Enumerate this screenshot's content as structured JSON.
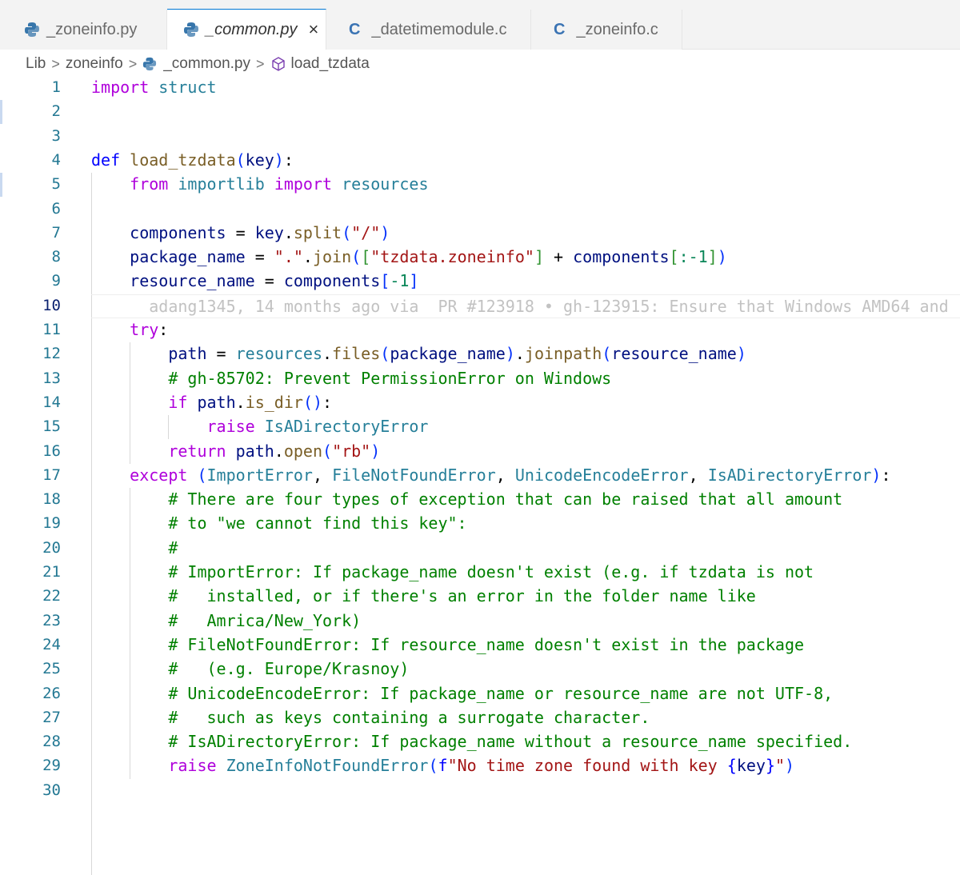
{
  "tabs": [
    {
      "label": "_zoneinfo.py",
      "icon": "python-icon",
      "active": false
    },
    {
      "label": "_common.py",
      "icon": "python-icon",
      "active": true,
      "close": "×"
    },
    {
      "label": "_datetimemodule.c",
      "icon": "c-icon",
      "icon_text": "C",
      "active": false
    },
    {
      "label": "_zoneinfo.c",
      "icon": "c-icon",
      "icon_text": "C",
      "active": false
    }
  ],
  "breadcrumb": {
    "items": [
      "Lib",
      "zoneinfo",
      "_common.py",
      "load_tzdata"
    ],
    "separator": ">"
  },
  "editor": {
    "current_line": 10,
    "line_numbers": [
      "1",
      "2",
      "3",
      "4",
      "5",
      "6",
      "7",
      "8",
      "9",
      "10",
      "11",
      "12",
      "13",
      "14",
      "15",
      "16",
      "17",
      "18",
      "19",
      "20",
      "21",
      "22",
      "23",
      "24",
      "25",
      "26",
      "27",
      "28",
      "29",
      "30"
    ],
    "lines": [
      [
        {
          "t": "import",
          "c": "k"
        },
        {
          "t": " "
        },
        {
          "t": "struct",
          "c": "t"
        }
      ],
      [],
      [],
      [
        {
          "t": "def",
          "c": "kd"
        },
        {
          "t": " "
        },
        {
          "t": "load_tzdata",
          "c": "fn"
        },
        {
          "t": "(",
          "c": "b1"
        },
        {
          "t": "key",
          "c": "v"
        },
        {
          "t": ")",
          "c": "b1"
        },
        {
          "t": ":"
        }
      ],
      [
        {
          "t": "    "
        },
        {
          "t": "from",
          "c": "k"
        },
        {
          "t": " "
        },
        {
          "t": "importlib",
          "c": "t"
        },
        {
          "t": " "
        },
        {
          "t": "import",
          "c": "k"
        },
        {
          "t": " "
        },
        {
          "t": "resources",
          "c": "t"
        }
      ],
      [],
      [
        {
          "t": "    "
        },
        {
          "t": "components",
          "c": "v"
        },
        {
          "t": " = "
        },
        {
          "t": "key",
          "c": "v"
        },
        {
          "t": "."
        },
        {
          "t": "split",
          "c": "fn"
        },
        {
          "t": "(",
          "c": "b1"
        },
        {
          "t": "\"/\"",
          "c": "s"
        },
        {
          "t": ")",
          "c": "b1"
        }
      ],
      [
        {
          "t": "    "
        },
        {
          "t": "package_name",
          "c": "v"
        },
        {
          "t": " = "
        },
        {
          "t": "\".\"",
          "c": "s"
        },
        {
          "t": "."
        },
        {
          "t": "join",
          "c": "fn"
        },
        {
          "t": "(",
          "c": "b1"
        },
        {
          "t": "[",
          "c": "b2"
        },
        {
          "t": "\"tzdata.zoneinfo\"",
          "c": "s"
        },
        {
          "t": "]",
          "c": "b2"
        },
        {
          "t": " + "
        },
        {
          "t": "components",
          "c": "v"
        },
        {
          "t": "[",
          "c": "b2"
        },
        {
          "t": ":-1",
          "c": "m"
        },
        {
          "t": "]",
          "c": "b2"
        },
        {
          "t": ")",
          "c": "b1"
        }
      ],
      [
        {
          "t": "    "
        },
        {
          "t": "resource_name",
          "c": "v"
        },
        {
          "t": " = "
        },
        {
          "t": "components",
          "c": "v"
        },
        {
          "t": "[",
          "c": "b1"
        },
        {
          "t": "-1",
          "c": "m"
        },
        {
          "t": "]",
          "c": "b1"
        }
      ],
      [
        {
          "t": "      adang1345, 14 months ago via  PR #123918 • gh-123915: Ensure that Windows AMD64 and",
          "c": "blame"
        }
      ],
      [
        {
          "t": "    "
        },
        {
          "t": "try",
          "c": "k"
        },
        {
          "t": ":"
        }
      ],
      [
        {
          "t": "        "
        },
        {
          "t": "path",
          "c": "v"
        },
        {
          "t": " = "
        },
        {
          "t": "resources",
          "c": "t"
        },
        {
          "t": "."
        },
        {
          "t": "files",
          "c": "fn"
        },
        {
          "t": "(",
          "c": "b1"
        },
        {
          "t": "package_name",
          "c": "v"
        },
        {
          "t": ")",
          "c": "b1"
        },
        {
          "t": "."
        },
        {
          "t": "joinpath",
          "c": "fn"
        },
        {
          "t": "(",
          "c": "b1"
        },
        {
          "t": "resource_name",
          "c": "v"
        },
        {
          "t": ")",
          "c": "b1"
        }
      ],
      [
        {
          "t": "        "
        },
        {
          "t": "# gh-85702: Prevent PermissionError on Windows",
          "c": "c"
        }
      ],
      [
        {
          "t": "        "
        },
        {
          "t": "if",
          "c": "k"
        },
        {
          "t": " "
        },
        {
          "t": "path",
          "c": "v"
        },
        {
          "t": "."
        },
        {
          "t": "is_dir",
          "c": "fn"
        },
        {
          "t": "()",
          "c": "b1"
        },
        {
          "t": ":"
        }
      ],
      [
        {
          "t": "            "
        },
        {
          "t": "raise",
          "c": "k"
        },
        {
          "t": " "
        },
        {
          "t": "IsADirectoryError",
          "c": "t"
        }
      ],
      [
        {
          "t": "        "
        },
        {
          "t": "return",
          "c": "k"
        },
        {
          "t": " "
        },
        {
          "t": "path",
          "c": "v"
        },
        {
          "t": "."
        },
        {
          "t": "open",
          "c": "fn"
        },
        {
          "t": "(",
          "c": "b1"
        },
        {
          "t": "\"rb\"",
          "c": "s"
        },
        {
          "t": ")",
          "c": "b1"
        }
      ],
      [
        {
          "t": "    "
        },
        {
          "t": "except",
          "c": "k"
        },
        {
          "t": " "
        },
        {
          "t": "(",
          "c": "b1"
        },
        {
          "t": "ImportError",
          "c": "t"
        },
        {
          "t": ", "
        },
        {
          "t": "FileNotFoundError",
          "c": "t"
        },
        {
          "t": ", "
        },
        {
          "t": "UnicodeEncodeError",
          "c": "t"
        },
        {
          "t": ", "
        },
        {
          "t": "IsADirectoryError",
          "c": "t"
        },
        {
          "t": ")",
          "c": "b1"
        },
        {
          "t": ":"
        }
      ],
      [
        {
          "t": "        "
        },
        {
          "t": "# There are four types of exception that can be raised that all amount",
          "c": "c"
        }
      ],
      [
        {
          "t": "        "
        },
        {
          "t": "# to \"we cannot find this key\":",
          "c": "c"
        }
      ],
      [
        {
          "t": "        "
        },
        {
          "t": "#",
          "c": "c"
        }
      ],
      [
        {
          "t": "        "
        },
        {
          "t": "# ImportError: If package_name doesn't exist (e.g. if tzdata is not",
          "c": "c"
        }
      ],
      [
        {
          "t": "        "
        },
        {
          "t": "#   installed, or if there's an error in the folder name like",
          "c": "c"
        }
      ],
      [
        {
          "t": "        "
        },
        {
          "t": "#   Amrica/New_York)",
          "c": "c"
        }
      ],
      [
        {
          "t": "        "
        },
        {
          "t": "# FileNotFoundError: If resource_name doesn't exist in the package",
          "c": "c"
        }
      ],
      [
        {
          "t": "        "
        },
        {
          "t": "#   (e.g. Europe/Krasnoy)",
          "c": "c"
        }
      ],
      [
        {
          "t": "        "
        },
        {
          "t": "# UnicodeEncodeError: If package_name or resource_name are not UTF-8,",
          "c": "c"
        }
      ],
      [
        {
          "t": "        "
        },
        {
          "t": "#   such as keys containing a surrogate character.",
          "c": "c"
        }
      ],
      [
        {
          "t": "        "
        },
        {
          "t": "# IsADirectoryError: If package_name without a resource_name specified.",
          "c": "c"
        }
      ],
      [
        {
          "t": "        "
        },
        {
          "t": "raise",
          "c": "k"
        },
        {
          "t": " "
        },
        {
          "t": "ZoneInfoNotFoundError",
          "c": "t"
        },
        {
          "t": "(",
          "c": "b1"
        },
        {
          "t": "f",
          "c": "kd"
        },
        {
          "t": "\"No time zone found with key ",
          "c": "s"
        },
        {
          "t": "{",
          "c": "kd"
        },
        {
          "t": "key",
          "c": "v"
        },
        {
          "t": "}",
          "c": "kd"
        },
        {
          "t": "\"",
          "c": "s"
        },
        {
          "t": ")",
          "c": "b1"
        }
      ],
      []
    ]
  }
}
